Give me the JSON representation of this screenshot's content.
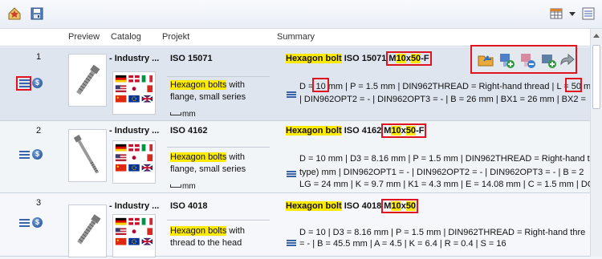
{
  "headers": {
    "preview": "Preview",
    "catalog": "Catalog",
    "project": "Projekt",
    "summary": "Summary"
  },
  "rows": [
    {
      "num": "1",
      "catalog": "- Industry ...",
      "project": "ISO 15071",
      "desc_pre": "",
      "desc_hl": "Hexagon bolts",
      "desc_post": " with flange, small series",
      "unit": "mm",
      "title_a": "Hexagon bolt",
      "title_b": " ISO 15071 ",
      "title_c": "M",
      "title_d": "10",
      "title_e": "x",
      "title_f": "50",
      "title_g": "-F",
      "line1": "D = 10 mm | P = 1.5 mm | DIN962THREAD = Right-hand thread | L = 50 mm",
      "line2": "| DIN962OPT2 = - | DIN962OPT3 = - | B = 26 mm | BX1 = 26 mm | BX2 ="
    },
    {
      "num": "2",
      "catalog": "- Industry ...",
      "project": "ISO 4162",
      "desc_pre": "",
      "desc_hl": "Hexagon bolts",
      "desc_post": " with flange, small series",
      "unit": "mm",
      "title_a": "Hexagon bolt",
      "title_b": " ISO 4162 ",
      "title_c": "M",
      "title_d": "10",
      "title_e": "x",
      "title_f": "50",
      "title_g": "-F",
      "line1": "D = 10 mm | D3 = 8.16 mm | P = 1.5 mm | DIN962THREAD = Right-hand t",
      "line2": "type) mm | DIN962OPT1 = - | DIN962OPT2 = - | DIN962OPT3 = - | B = 2",
      "line3": "LG = 24 mm | K = 9.7 mm | K1 = 4.3 mm | E = 14.08 mm | C = 1.5 mm | DC"
    },
    {
      "num": "3",
      "catalog": "- Industry ...",
      "project": "ISO 4018",
      "desc_pre": "",
      "desc_hl": "Hexagon bolts",
      "desc_post": " with thread to the head",
      "unit": "mm",
      "title_a": "Hexagon bolt",
      "title_b": " ISO 4018 ",
      "title_c": "M",
      "title_d": "10",
      "title_e": "x",
      "title_f": "50",
      "title_g": "",
      "line1": "D = 10 | D3 = 8.16 mm | P = 1.5 mm | DIN962THREAD = Right-hand thre",
      "line2": "= - | B = 45.5 mm | A = 4.5 | K = 6.4 | R = 0.4 | S = 16"
    }
  ],
  "highlight_color": "#ffea00",
  "marker_color": "#e0141e",
  "icons": [
    "home-star-icon",
    "save-icon",
    "view-grid-icon",
    "dropdown-icon",
    "details-view-icon",
    "open-folder-icon",
    "add-part-icon",
    "remove-part-icon",
    "add-to-cart-icon",
    "export-icon"
  ]
}
